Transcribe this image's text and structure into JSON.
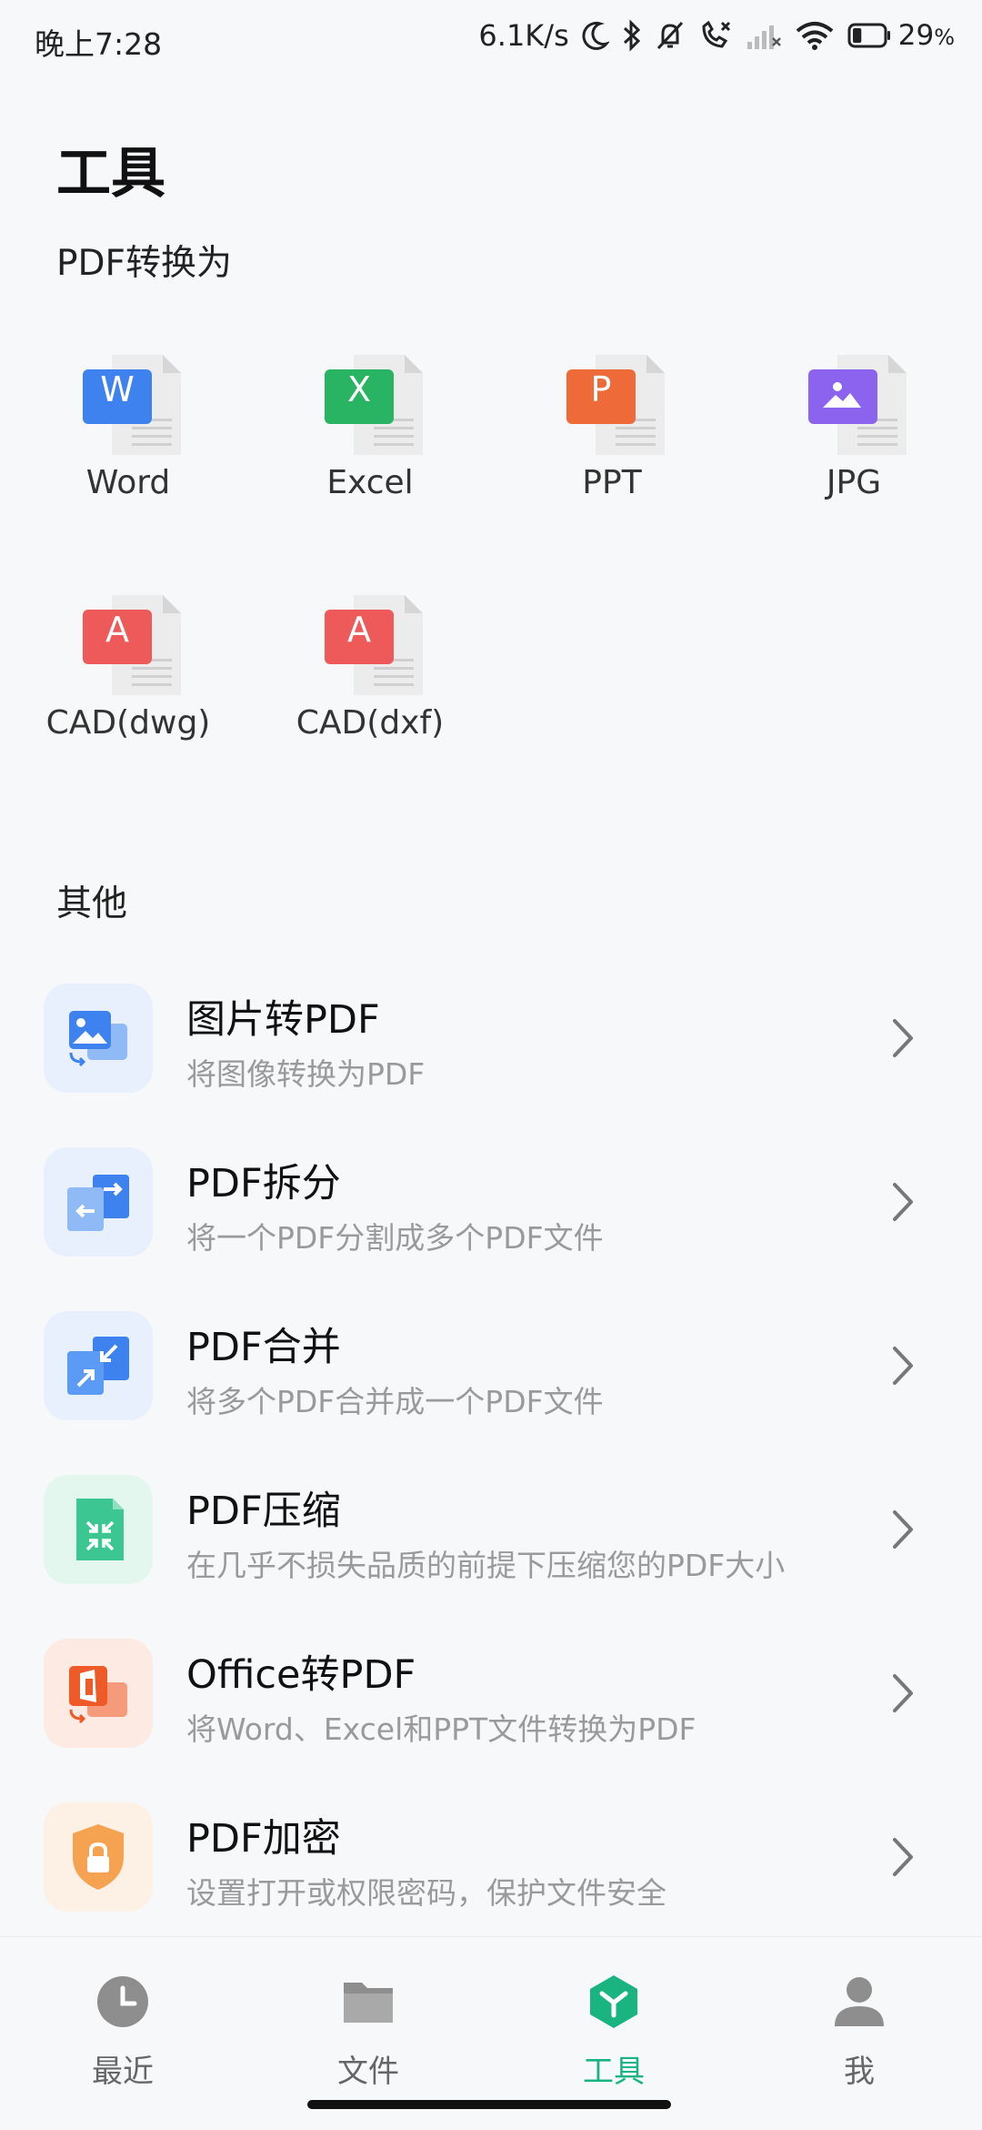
{
  "status_bar": {
    "time": "晚上7:28",
    "net_speed": "6.1K/s",
    "battery": "29",
    "battery_unit": "%",
    "battery_level": 0.29,
    "icons": [
      "moon-icon",
      "bluetooth-icon",
      "bell-muted-icon",
      "call-blocked-icon",
      "signal-icon",
      "wifi-icon",
      "battery-icon"
    ]
  },
  "page": {
    "title": "工具",
    "convert_section_label": "PDF转换为",
    "other_section_label": "其他"
  },
  "convert_items": [
    {
      "label": "Word",
      "badge": "W",
      "color": "#3e82f0"
    },
    {
      "label": "Excel",
      "badge": "X",
      "color": "#28b463"
    },
    {
      "label": "PPT",
      "badge": "P",
      "color": "#ee6a38"
    },
    {
      "label": "JPG",
      "badge": "",
      "color": "#8b63ee"
    },
    {
      "label": "CAD(dwg)",
      "badge": "A",
      "color": "#ee5a5a"
    },
    {
      "label": "CAD(dxf)",
      "badge": "A",
      "color": "#ee5a5a"
    }
  ],
  "tools": [
    {
      "title": "图片转PDF",
      "desc": "将图像转换为PDF",
      "icon": "image-to-pdf-icon",
      "bg": "#e8f0fd"
    },
    {
      "title": "PDF拆分",
      "desc": "将一个PDF分割成多个PDF文件",
      "icon": "pdf-split-icon",
      "bg": "#e8f0fd"
    },
    {
      "title": "PDF合并",
      "desc": "将多个PDF合并成一个PDF文件",
      "icon": "pdf-merge-icon",
      "bg": "#e8f0fd"
    },
    {
      "title": "PDF压缩",
      "desc": "在几乎不损失品质的前提下压缩您的PDF大小",
      "icon": "pdf-compress-icon",
      "bg": "#e4f7ef"
    },
    {
      "title": "Office转PDF",
      "desc": "将Word、Excel和PPT文件转换为PDF",
      "icon": "office-to-pdf-icon",
      "bg": "#fdeae3"
    },
    {
      "title": "PDF加密",
      "desc": "设置打开或权限密码，保护文件安全",
      "icon": "pdf-encrypt-icon",
      "bg": "#fdf0e4"
    }
  ],
  "nav": [
    {
      "label": "最近",
      "icon": "clock-icon",
      "active": false
    },
    {
      "label": "文件",
      "icon": "folder-icon",
      "active": false
    },
    {
      "label": "工具",
      "icon": "tools-icon",
      "active": true
    },
    {
      "label": "我",
      "icon": "person-icon",
      "active": false
    }
  ],
  "colors": {
    "accent": "#19b47f",
    "nav_inactive": "#8e8e8e"
  }
}
